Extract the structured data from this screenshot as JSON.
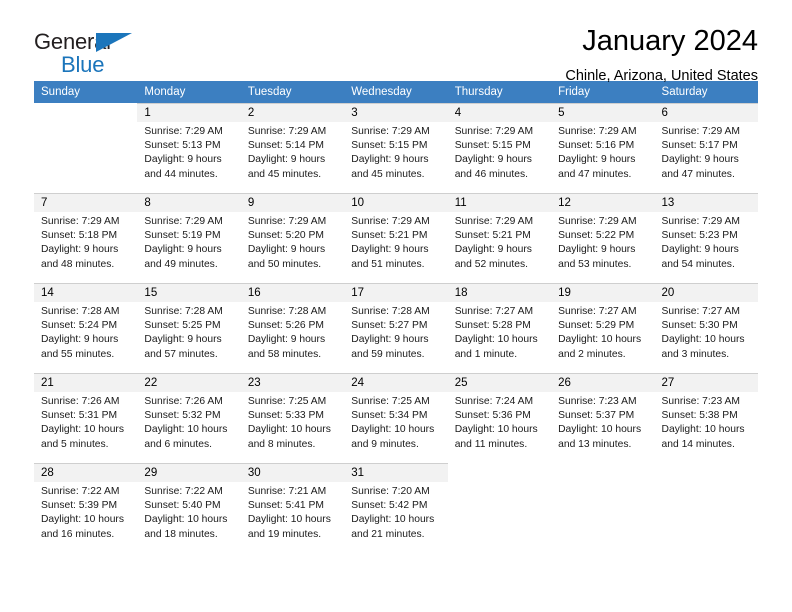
{
  "brand": {
    "line1": "General",
    "line2": "Blue",
    "triangle_color": "#1b75bb",
    "text_color": "#231f20"
  },
  "header": {
    "title": "January 2024",
    "subtitle": "Chinle, Arizona, United States"
  },
  "theme": {
    "header_row_bg": "#3c7fc1",
    "header_row_text": "#ffffff",
    "daynum_band_bg": "#f2f2f2",
    "grid_line": "#cfcfcf"
  },
  "weekdays": [
    "Sunday",
    "Monday",
    "Tuesday",
    "Wednesday",
    "Thursday",
    "Friday",
    "Saturday"
  ],
  "weeks": [
    [
      {
        "day": "",
        "sunrise": "",
        "sunset": "",
        "daylight1": "",
        "daylight2": ""
      },
      {
        "day": "1",
        "sunrise": "Sunrise: 7:29 AM",
        "sunset": "Sunset: 5:13 PM",
        "daylight1": "Daylight: 9 hours",
        "daylight2": "and 44 minutes."
      },
      {
        "day": "2",
        "sunrise": "Sunrise: 7:29 AM",
        "sunset": "Sunset: 5:14 PM",
        "daylight1": "Daylight: 9 hours",
        "daylight2": "and 45 minutes."
      },
      {
        "day": "3",
        "sunrise": "Sunrise: 7:29 AM",
        "sunset": "Sunset: 5:15 PM",
        "daylight1": "Daylight: 9 hours",
        "daylight2": "and 45 minutes."
      },
      {
        "day": "4",
        "sunrise": "Sunrise: 7:29 AM",
        "sunset": "Sunset: 5:15 PM",
        "daylight1": "Daylight: 9 hours",
        "daylight2": "and 46 minutes."
      },
      {
        "day": "5",
        "sunrise": "Sunrise: 7:29 AM",
        "sunset": "Sunset: 5:16 PM",
        "daylight1": "Daylight: 9 hours",
        "daylight2": "and 47 minutes."
      },
      {
        "day": "6",
        "sunrise": "Sunrise: 7:29 AM",
        "sunset": "Sunset: 5:17 PM",
        "daylight1": "Daylight: 9 hours",
        "daylight2": "and 47 minutes."
      }
    ],
    [
      {
        "day": "7",
        "sunrise": "Sunrise: 7:29 AM",
        "sunset": "Sunset: 5:18 PM",
        "daylight1": "Daylight: 9 hours",
        "daylight2": "and 48 minutes."
      },
      {
        "day": "8",
        "sunrise": "Sunrise: 7:29 AM",
        "sunset": "Sunset: 5:19 PM",
        "daylight1": "Daylight: 9 hours",
        "daylight2": "and 49 minutes."
      },
      {
        "day": "9",
        "sunrise": "Sunrise: 7:29 AM",
        "sunset": "Sunset: 5:20 PM",
        "daylight1": "Daylight: 9 hours",
        "daylight2": "and 50 minutes."
      },
      {
        "day": "10",
        "sunrise": "Sunrise: 7:29 AM",
        "sunset": "Sunset: 5:21 PM",
        "daylight1": "Daylight: 9 hours",
        "daylight2": "and 51 minutes."
      },
      {
        "day": "11",
        "sunrise": "Sunrise: 7:29 AM",
        "sunset": "Sunset: 5:21 PM",
        "daylight1": "Daylight: 9 hours",
        "daylight2": "and 52 minutes."
      },
      {
        "day": "12",
        "sunrise": "Sunrise: 7:29 AM",
        "sunset": "Sunset: 5:22 PM",
        "daylight1": "Daylight: 9 hours",
        "daylight2": "and 53 minutes."
      },
      {
        "day": "13",
        "sunrise": "Sunrise: 7:29 AM",
        "sunset": "Sunset: 5:23 PM",
        "daylight1": "Daylight: 9 hours",
        "daylight2": "and 54 minutes."
      }
    ],
    [
      {
        "day": "14",
        "sunrise": "Sunrise: 7:28 AM",
        "sunset": "Sunset: 5:24 PM",
        "daylight1": "Daylight: 9 hours",
        "daylight2": "and 55 minutes."
      },
      {
        "day": "15",
        "sunrise": "Sunrise: 7:28 AM",
        "sunset": "Sunset: 5:25 PM",
        "daylight1": "Daylight: 9 hours",
        "daylight2": "and 57 minutes."
      },
      {
        "day": "16",
        "sunrise": "Sunrise: 7:28 AM",
        "sunset": "Sunset: 5:26 PM",
        "daylight1": "Daylight: 9 hours",
        "daylight2": "and 58 minutes."
      },
      {
        "day": "17",
        "sunrise": "Sunrise: 7:28 AM",
        "sunset": "Sunset: 5:27 PM",
        "daylight1": "Daylight: 9 hours",
        "daylight2": "and 59 minutes."
      },
      {
        "day": "18",
        "sunrise": "Sunrise: 7:27 AM",
        "sunset": "Sunset: 5:28 PM",
        "daylight1": "Daylight: 10 hours",
        "daylight2": "and 1 minute."
      },
      {
        "day": "19",
        "sunrise": "Sunrise: 7:27 AM",
        "sunset": "Sunset: 5:29 PM",
        "daylight1": "Daylight: 10 hours",
        "daylight2": "and 2 minutes."
      },
      {
        "day": "20",
        "sunrise": "Sunrise: 7:27 AM",
        "sunset": "Sunset: 5:30 PM",
        "daylight1": "Daylight: 10 hours",
        "daylight2": "and 3 minutes."
      }
    ],
    [
      {
        "day": "21",
        "sunrise": "Sunrise: 7:26 AM",
        "sunset": "Sunset: 5:31 PM",
        "daylight1": "Daylight: 10 hours",
        "daylight2": "and 5 minutes."
      },
      {
        "day": "22",
        "sunrise": "Sunrise: 7:26 AM",
        "sunset": "Sunset: 5:32 PM",
        "daylight1": "Daylight: 10 hours",
        "daylight2": "and 6 minutes."
      },
      {
        "day": "23",
        "sunrise": "Sunrise: 7:25 AM",
        "sunset": "Sunset: 5:33 PM",
        "daylight1": "Daylight: 10 hours",
        "daylight2": "and 8 minutes."
      },
      {
        "day": "24",
        "sunrise": "Sunrise: 7:25 AM",
        "sunset": "Sunset: 5:34 PM",
        "daylight1": "Daylight: 10 hours",
        "daylight2": "and 9 minutes."
      },
      {
        "day": "25",
        "sunrise": "Sunrise: 7:24 AM",
        "sunset": "Sunset: 5:36 PM",
        "daylight1": "Daylight: 10 hours",
        "daylight2": "and 11 minutes."
      },
      {
        "day": "26",
        "sunrise": "Sunrise: 7:23 AM",
        "sunset": "Sunset: 5:37 PM",
        "daylight1": "Daylight: 10 hours",
        "daylight2": "and 13 minutes."
      },
      {
        "day": "27",
        "sunrise": "Sunrise: 7:23 AM",
        "sunset": "Sunset: 5:38 PM",
        "daylight1": "Daylight: 10 hours",
        "daylight2": "and 14 minutes."
      }
    ],
    [
      {
        "day": "28",
        "sunrise": "Sunrise: 7:22 AM",
        "sunset": "Sunset: 5:39 PM",
        "daylight1": "Daylight: 10 hours",
        "daylight2": "and 16 minutes."
      },
      {
        "day": "29",
        "sunrise": "Sunrise: 7:22 AM",
        "sunset": "Sunset: 5:40 PM",
        "daylight1": "Daylight: 10 hours",
        "daylight2": "and 18 minutes."
      },
      {
        "day": "30",
        "sunrise": "Sunrise: 7:21 AM",
        "sunset": "Sunset: 5:41 PM",
        "daylight1": "Daylight: 10 hours",
        "daylight2": "and 19 minutes."
      },
      {
        "day": "31",
        "sunrise": "Sunrise: 7:20 AM",
        "sunset": "Sunset: 5:42 PM",
        "daylight1": "Daylight: 10 hours",
        "daylight2": "and 21 minutes."
      },
      {
        "day": "",
        "sunrise": "",
        "sunset": "",
        "daylight1": "",
        "daylight2": ""
      },
      {
        "day": "",
        "sunrise": "",
        "sunset": "",
        "daylight1": "",
        "daylight2": ""
      },
      {
        "day": "",
        "sunrise": "",
        "sunset": "",
        "daylight1": "",
        "daylight2": ""
      }
    ]
  ]
}
